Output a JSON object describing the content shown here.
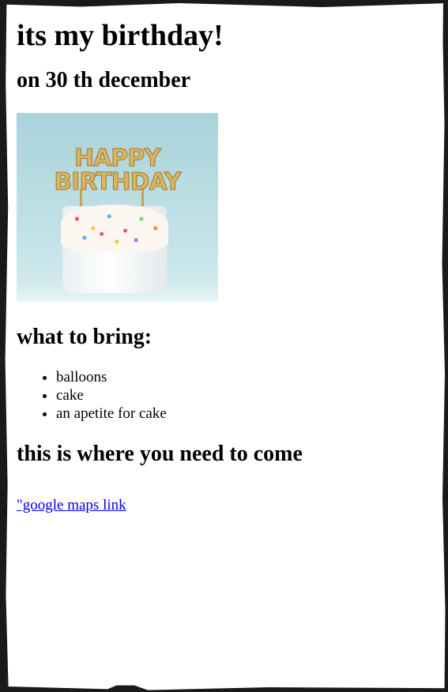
{
  "page": {
    "title": "its my birthday!",
    "date_heading": "on 30 th december",
    "image": {
      "topper_line1": "HAPPY",
      "topper_line2": "BIRTHDAY"
    },
    "bring_heading": "what to bring:",
    "bring_items": [
      "balloons",
      "cake",
      "an apetite for cake"
    ],
    "where_heading": "this is where you need to come",
    "maps_link_text": "\"google maps link"
  },
  "colors": {
    "link": "#0000ee",
    "frame": "#1a1a1a",
    "background": "#ffffff"
  }
}
